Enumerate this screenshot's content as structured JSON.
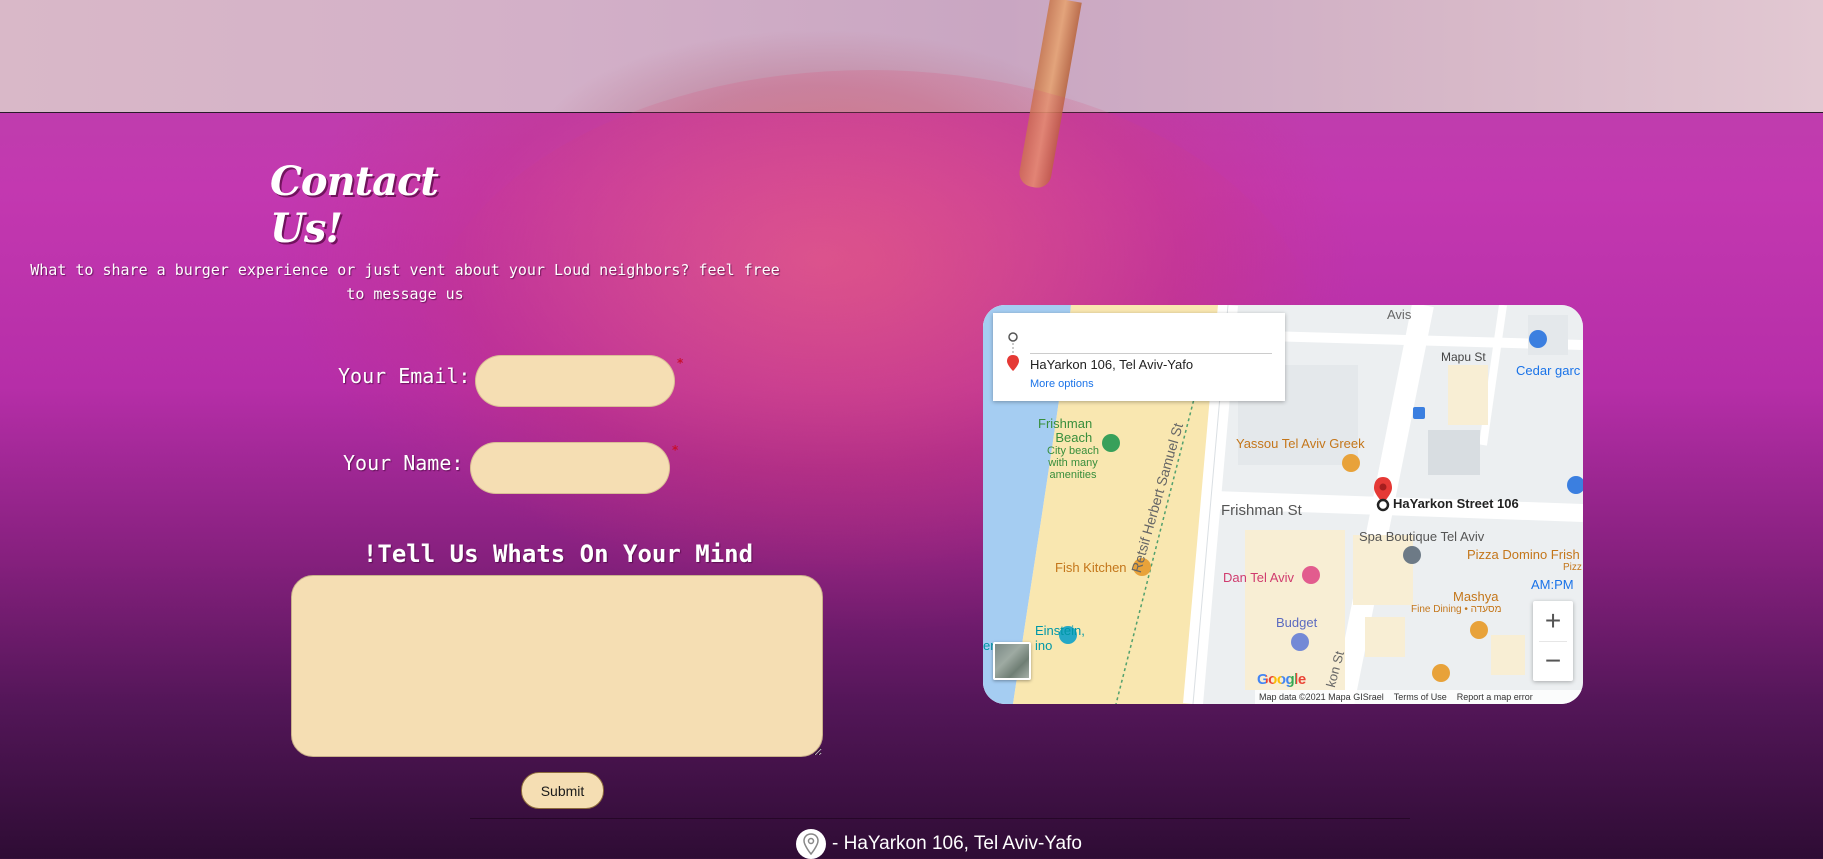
{
  "page": {
    "title": "Contact Us!",
    "intro": "What to share a burger experience or just vent about your Loud neighbors? feel free to message us"
  },
  "form": {
    "email_label": "Your Email:",
    "email_value": "",
    "name_label": "Your Name:",
    "name_value": "",
    "required_mark": "*",
    "message_title": "!Tell Us Whats On Your Mind",
    "message_value": "",
    "submit_label": "Submit"
  },
  "map": {
    "directions_address": "HaYarkon 106, Tel Aviv-Yafo",
    "more_options": "More options",
    "marker_label": "HaYarkon Street 106",
    "places": {
      "avis": "Avis",
      "mapu_st": "Mapu St",
      "cedar": "Cedar garc",
      "frishman_beach": "Frishman\nBeach",
      "beach_desc": "City beach\nwith many\namenities",
      "yassou": "Yassou Tel Aviv Greek",
      "frishman_st": "Frishman St",
      "retsif": "Retsif Herbert Samuel St",
      "spa": "Spa Boutique Tel Aviv",
      "pizza": "Pizza Domino Frish",
      "pizza2": "Pizz",
      "ampm": "AM:PM",
      "fish_kitchen": "Fish Kitchen",
      "dan": "Dan Tel Aviv",
      "mashya": "Mashya",
      "mashya_desc": "Fine Dining • מסעדה",
      "budget": "Budget",
      "einstein": "Einstein,",
      "einstein2": "er",
      "einstein3": "ino",
      "hayarkon_st": "kon St"
    },
    "zoom_in": "+",
    "zoom_out": "−",
    "google": "Google",
    "attribution": {
      "data": "Map data ©2021 Mapa GISrael",
      "terms": "Terms of Use",
      "report": "Report a map error"
    },
    "colors": {
      "sea": "#a5cdf2",
      "sand": "#f9e7b0",
      "road": "#ffffff",
      "block": "#e8ecef",
      "food": "#e8a23a",
      "marker": "#e53935"
    }
  },
  "footer": {
    "address": "- HaYarkon 106, Tel Aviv-Yafo",
    "icon": "location-pin-icon"
  }
}
